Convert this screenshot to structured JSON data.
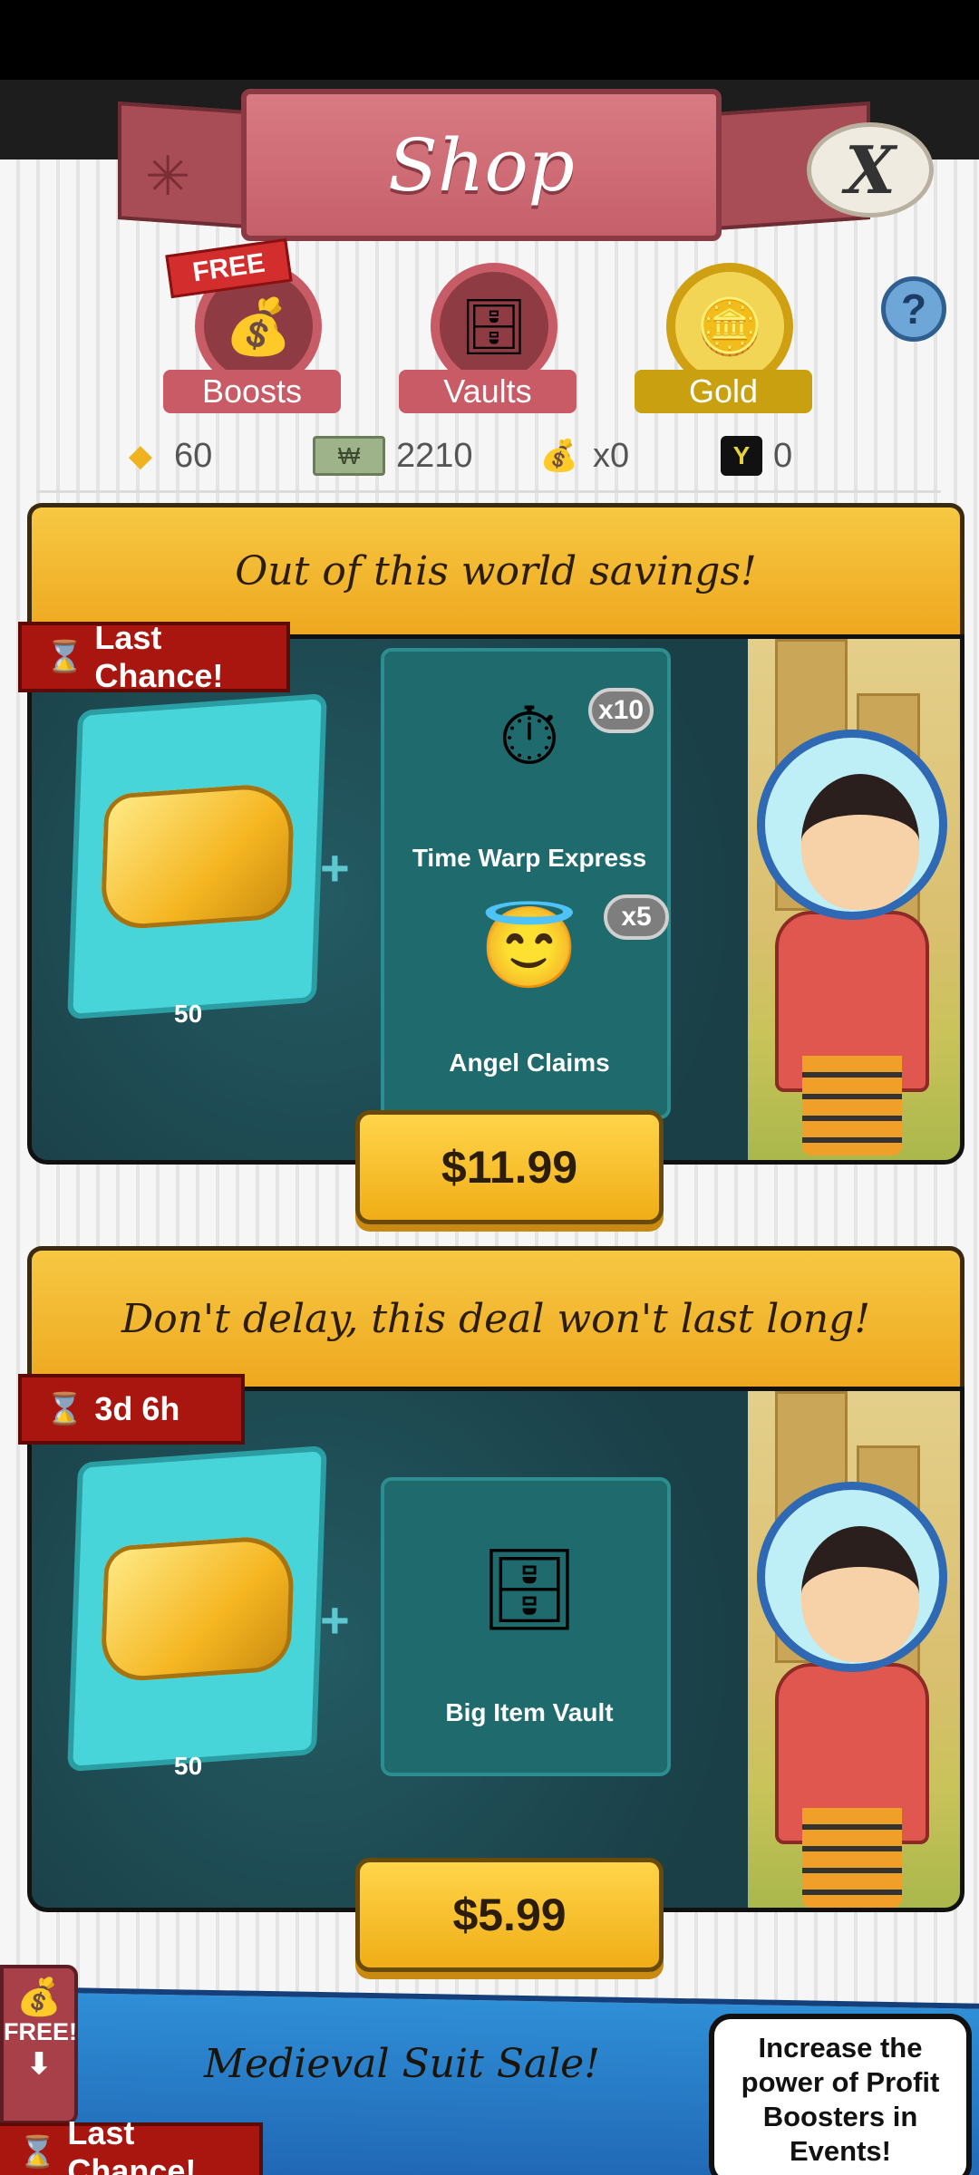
{
  "header": {
    "title": "Shop",
    "close_label": "X"
  },
  "tabs": [
    {
      "label": "Boosts",
      "badge": "FREE",
      "icon": "money-bag-icon"
    },
    {
      "label": "Vaults",
      "icon": "vault-icon"
    },
    {
      "label": "Gold",
      "icon": "gold-icon",
      "selected": true
    }
  ],
  "help_label": "?",
  "currencies": [
    {
      "icon": "gold-icon",
      "value": "60"
    },
    {
      "icon": "megabucks-icon",
      "value": "2210"
    },
    {
      "icon": "money-bag-icon",
      "value": "x0"
    },
    {
      "icon": "event-token-icon",
      "value": "0"
    }
  ],
  "offers": [
    {
      "title": "Out of this world savings!",
      "timer": "Last Chance!",
      "gold_amount": "50",
      "items": [
        {
          "name": "Time Warp Express",
          "qty": "x10",
          "icon": "stopwatch-icon"
        },
        {
          "name": "Angel Claims",
          "qty": "x5",
          "icon": "angel-icon"
        }
      ],
      "price": "$11.99"
    },
    {
      "title": "Don't delay, this deal won't last long!",
      "timer": "3d 6h",
      "gold_amount": "50",
      "items": [
        {
          "name": "Big Item Vault",
          "icon": "vault-icon"
        }
      ],
      "price": "$5.99"
    }
  ],
  "bottom": {
    "banner_title": "Medieval Suit Sale!",
    "timer": "Last Chance!",
    "tooltip": "Increase the power of Profit Boosters in Events!",
    "side_button": "FREE!"
  },
  "colors": {
    "accent": "#f0ad16",
    "header_pink": "#c6606a",
    "card_body": "#1d4a52",
    "timer_red": "#a8160f"
  }
}
